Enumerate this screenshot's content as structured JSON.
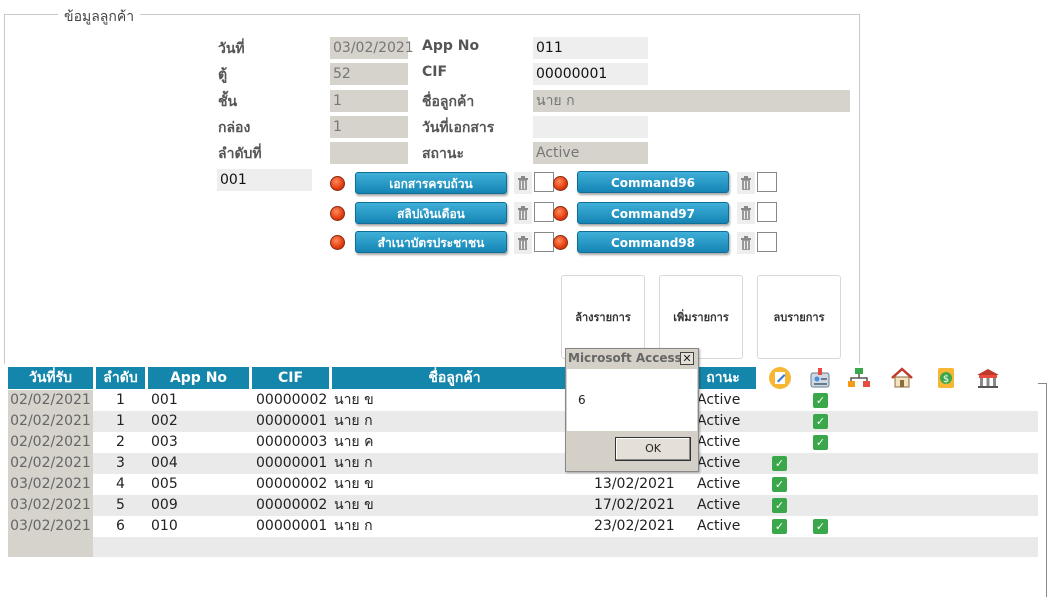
{
  "form": {
    "group_title": "ข้อมูลลูกค้า",
    "labels": {
      "date": "วันที่",
      "cabinet": "ตู้",
      "shelf": "ชั้น",
      "box": "กล่อง",
      "order": "ลำดับที่",
      "app_no": "App No",
      "cif": "CIF",
      "customer_name": "ชื่อลูกค้า",
      "doc_date": "วันที่เอกสาร",
      "status": "สถานะ"
    },
    "values": {
      "date": "03/02/2021",
      "cabinet": "52",
      "shelf": "1",
      "box": "1",
      "order": "",
      "app_no": "011",
      "cif": "00000001",
      "customer_name": "นาย ก",
      "doc_date": "",
      "status": "Active",
      "record_no": "001"
    }
  },
  "commands": {
    "left": [
      "เอกสารครบถ้วน",
      "สลิปเงินเดือน",
      "สำเนาบัตรประชาชน"
    ],
    "right": [
      "Command96",
      "Command97",
      "Command98"
    ]
  },
  "actions": {
    "clear": "ล้างรายการ",
    "add": "เพิ่มรายการ",
    "delete": "ลบรายการ"
  },
  "table": {
    "headers": [
      "วันที่รับ",
      "ลำดับ",
      "App No",
      "CIF",
      "ชื่อลูกค้า",
      "สถานะ"
    ],
    "status_header_visible": "ถานะ",
    "rows": [
      {
        "date": "02/02/2021",
        "seq": "1",
        "app": "001",
        "cif": "00000002",
        "name": "นาย ข",
        "doc_date": "",
        "status": "Active",
        "chk1": false,
        "chk2": true
      },
      {
        "date": "02/02/2021",
        "seq": "1",
        "app": "002",
        "cif": "00000001",
        "name": "นาย ก",
        "doc_date": "",
        "status": "Active",
        "chk1": false,
        "chk2": true
      },
      {
        "date": "02/02/2021",
        "seq": "2",
        "app": "003",
        "cif": "00000003",
        "name": "นาย ค",
        "doc_date": "",
        "status": "Active",
        "chk1": false,
        "chk2": true
      },
      {
        "date": "02/02/2021",
        "seq": "3",
        "app": "004",
        "cif": "00000001",
        "name": "นาย ก",
        "doc_date": "",
        "status": "Active",
        "chk1": true,
        "chk2": false
      },
      {
        "date": "03/02/2021",
        "seq": "4",
        "app": "005",
        "cif": "00000002",
        "name": "นาย ข",
        "doc_date": "13/02/2021",
        "status": "Active",
        "chk1": true,
        "chk2": false
      },
      {
        "date": "03/02/2021",
        "seq": "5",
        "app": "009",
        "cif": "00000002",
        "name": "นาย ข",
        "doc_date": "17/02/2021",
        "status": "Active",
        "chk1": true,
        "chk2": false
      },
      {
        "date": "03/02/2021",
        "seq": "6",
        "app": "010",
        "cif": "00000001",
        "name": "นาย ก",
        "doc_date": "23/02/2021",
        "status": "Active",
        "chk1": true,
        "chk2": true
      }
    ]
  },
  "header_icons": [
    "edit-note-icon",
    "id-card-icon",
    "network-icon",
    "home-icon",
    "money-icon",
    "bank-icon"
  ],
  "colors": {
    "accent": "#1486ab",
    "check_green": "#3aa84a",
    "field_gray": "#d6d2cc",
    "indicator_red": "#e33d10"
  },
  "dialog": {
    "title": "Microsoft Access",
    "message": "6",
    "ok_label": "OK",
    "close_glyph": "✕"
  }
}
